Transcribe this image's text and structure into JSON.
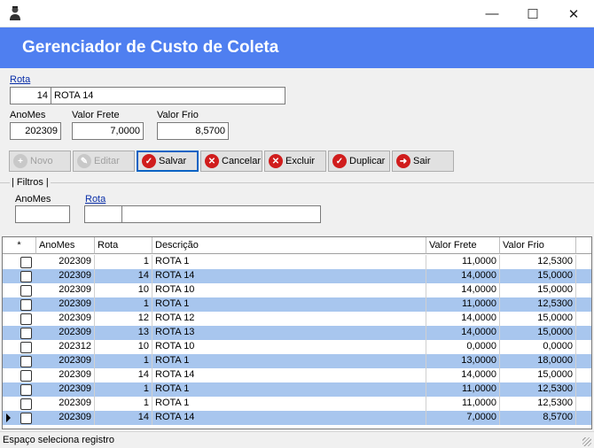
{
  "window": {
    "minimize": "—",
    "maximize": "☐",
    "close": "✕"
  },
  "header": {
    "title": "Gerenciador de Custo de Coleta"
  },
  "form": {
    "rota_label": "Rota",
    "rota_code": "14",
    "rota_name": "ROTA 14",
    "anomes_label": "AnoMes",
    "anomes_value": "202309",
    "valor_frete_label": "Valor Frete",
    "valor_frete_value": "7,0000",
    "valor_frio_label": "Valor Frio",
    "valor_frio_value": "8,5700"
  },
  "toolbar": {
    "novo": "Novo",
    "editar": "Editar",
    "salvar": "Salvar",
    "cancelar": "Cancelar",
    "excluir": "Excluir",
    "duplicar": "Duplicar",
    "sair": "Sair"
  },
  "filters": {
    "title": "Filtros",
    "anomes_label": "AnoMes",
    "anomes_value": "",
    "rota_label": "Rota",
    "rota_code": "",
    "rota_name": ""
  },
  "grid": {
    "columns": [
      "*",
      "AnoMes",
      "Rota",
      "Descrição",
      "Valor Frete",
      "Valor Frio"
    ],
    "rows": [
      {
        "anomes": "202309",
        "rota": "1",
        "descricao": "ROTA 1",
        "frete": "11,0000",
        "frio": "12,5300"
      },
      {
        "anomes": "202309",
        "rota": "14",
        "descricao": "ROTA 14",
        "frete": "14,0000",
        "frio": "15,0000"
      },
      {
        "anomes": "202309",
        "rota": "10",
        "descricao": "ROTA 10",
        "frete": "14,0000",
        "frio": "15,0000"
      },
      {
        "anomes": "202309",
        "rota": "1",
        "descricao": "ROTA 1",
        "frete": "11,0000",
        "frio": "12,5300"
      },
      {
        "anomes": "202309",
        "rota": "12",
        "descricao": "ROTA 12",
        "frete": "14,0000",
        "frio": "15,0000"
      },
      {
        "anomes": "202309",
        "rota": "13",
        "descricao": "ROTA 13",
        "frete": "14,0000",
        "frio": "15,0000"
      },
      {
        "anomes": "202312",
        "rota": "10",
        "descricao": "ROTA 10",
        "frete": "0,0000",
        "frio": "0,0000"
      },
      {
        "anomes": "202309",
        "rota": "1",
        "descricao": "ROTA 1",
        "frete": "13,0000",
        "frio": "18,0000"
      },
      {
        "anomes": "202309",
        "rota": "14",
        "descricao": "ROTA 14",
        "frete": "14,0000",
        "frio": "15,0000"
      },
      {
        "anomes": "202309",
        "rota": "1",
        "descricao": "ROTA 1",
        "frete": "11,0000",
        "frio": "12,5300"
      },
      {
        "anomes": "202309",
        "rota": "1",
        "descricao": "ROTA 1",
        "frete": "11,0000",
        "frio": "12,5300"
      },
      {
        "anomes": "202309",
        "rota": "14",
        "descricao": "ROTA 14",
        "frete": "7,0000",
        "frio": "8,5700"
      }
    ]
  },
  "status": {
    "text": "Espaço seleciona registro"
  }
}
